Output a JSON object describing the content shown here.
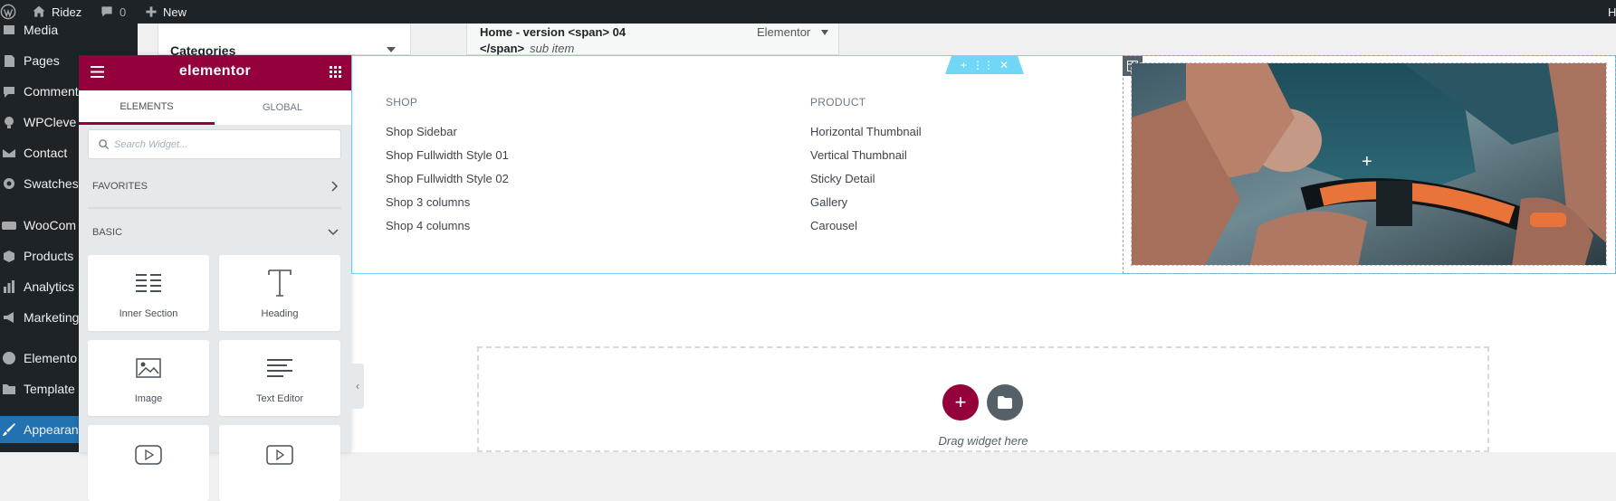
{
  "admin_bar": {
    "site_name": "Ridez",
    "comments_count": "0",
    "new_label": "New",
    "right_cut": "H"
  },
  "wp_menu": {
    "items": [
      {
        "label": "Media",
        "icon": "media-icon"
      },
      {
        "label": "Pages",
        "icon": "pages-icon"
      },
      {
        "label": "Comments",
        "icon": "comments-icon"
      },
      {
        "label": "WPCleve",
        "icon": "bulb-icon"
      },
      {
        "label": "Contact",
        "icon": "mail-icon"
      },
      {
        "label": "Swatches",
        "icon": "gear-icon"
      },
      {
        "label": "WooCom",
        "icon": "woo-icon"
      },
      {
        "label": "Products",
        "icon": "products-icon"
      },
      {
        "label": "Analytics",
        "icon": "bar-chart-icon"
      },
      {
        "label": "Marketing",
        "icon": "megaphone-icon"
      },
      {
        "label": "Elemento",
        "icon": "elementor-icon"
      },
      {
        "label": "Template",
        "icon": "folder-icon"
      },
      {
        "label": "Appearan",
        "icon": "brush-icon"
      }
    ]
  },
  "menu_editor": {
    "categories_label": "Categories",
    "item_title_line1": "Home - version <span> 04",
    "item_title_line2": "</span>",
    "item_subtitle": "sub item",
    "item_type": "Elementor"
  },
  "panel": {
    "logo": "elementor",
    "tabs": [
      "ELEMENTS",
      "GLOBAL"
    ],
    "search_placeholder": "Search Widget...",
    "favorites_label": "FAVORITES",
    "basic_label": "BASIC",
    "widgets": [
      {
        "label": "Inner Section",
        "icon": "inner-section-icon"
      },
      {
        "label": "Heading",
        "icon": "heading-icon"
      },
      {
        "label": "Image",
        "icon": "image-icon"
      },
      {
        "label": "Text Editor",
        "icon": "text-editor-icon"
      }
    ]
  },
  "mega_menu": {
    "columns": [
      {
        "title": "SHOP",
        "links": [
          "Shop Sidebar",
          "Shop Fullwidth Style 01",
          "Shop Fullwidth Style 02",
          "Shop 3 columns",
          "Shop 4 columns"
        ]
      },
      {
        "title": "PRODUCT",
        "links": [
          "Horizontal Thumbnail",
          "Vertical Thumbnail",
          "Sticky Detail",
          "Gallery",
          "Carousel"
        ]
      }
    ]
  },
  "canvas": {
    "drag_label": "Drag widget here"
  },
  "colors": {
    "admin_bar": "#1d2327",
    "elementor_brand": "#93003c",
    "section_outline": "#71d7f7",
    "wp_current": "#2271b1"
  }
}
